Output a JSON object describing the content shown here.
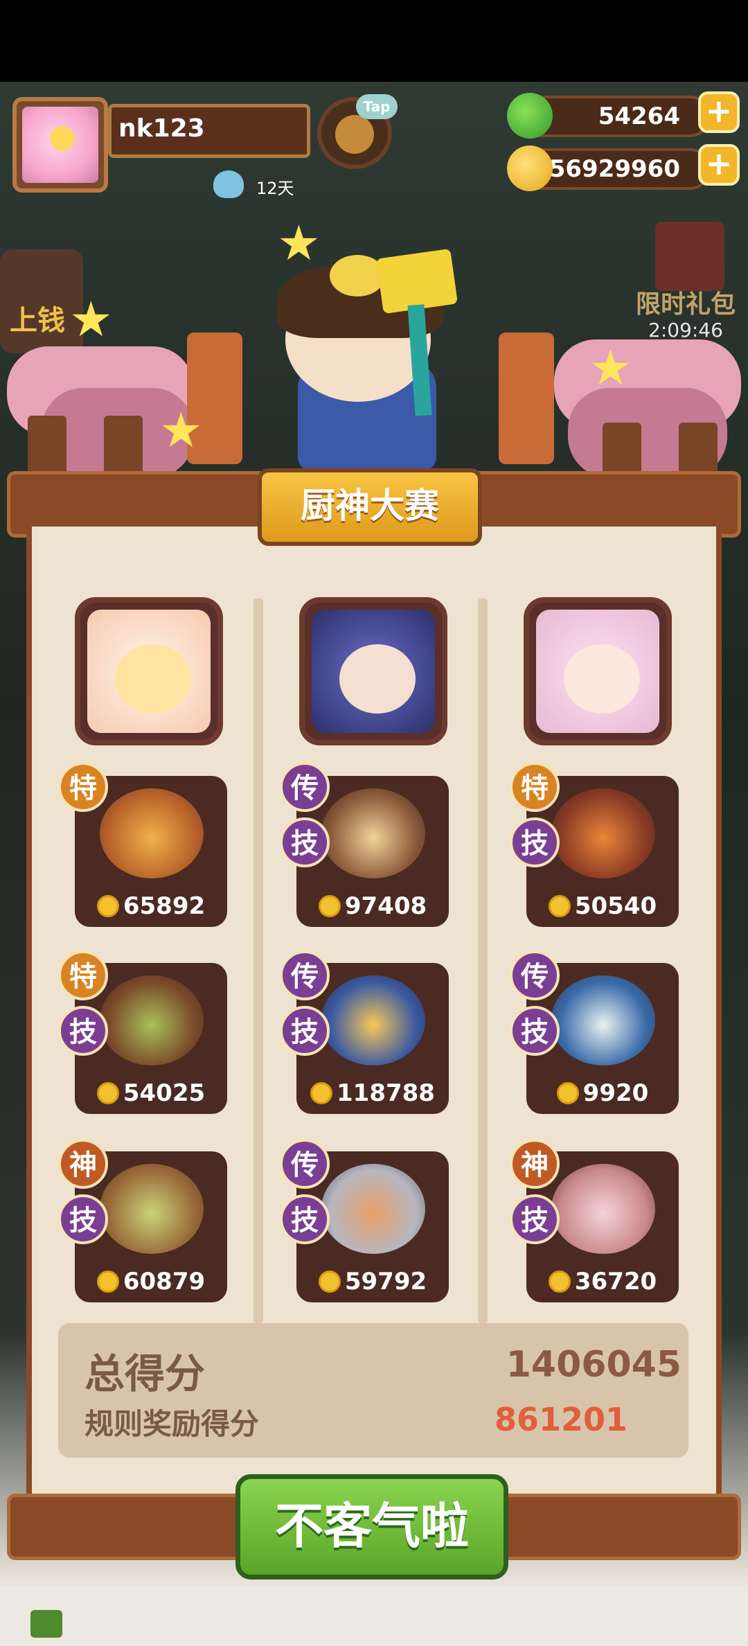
{
  "player": {
    "name": "nk123",
    "days": "12天",
    "tap_label": "Tap"
  },
  "resources": {
    "apples": "54264",
    "coins": "56929960",
    "plus": "+"
  },
  "side": {
    "left_label": "上钱",
    "gift_label": "限时礼包",
    "gift_timer": "2:09:46"
  },
  "contest": {
    "title": "厨神大赛",
    "columns": [
      {
        "dishes": [
          {
            "badges": [
              "特"
            ],
            "score": "65892"
          },
          {
            "badges": [
              "特",
              "技"
            ],
            "score": "54025"
          },
          {
            "badges": [
              "神",
              "技"
            ],
            "score": "60879"
          }
        ]
      },
      {
        "dishes": [
          {
            "badges": [
              "传",
              "技"
            ],
            "score": "97408"
          },
          {
            "badges": [
              "传",
              "技"
            ],
            "score": "118788"
          },
          {
            "badges": [
              "传",
              "技"
            ],
            "score": "59792"
          }
        ]
      },
      {
        "dishes": [
          {
            "badges": [
              "特",
              "技"
            ],
            "score": "50540"
          },
          {
            "badges": [
              "传",
              "技"
            ],
            "score": "9920"
          },
          {
            "badges": [
              "神",
              "技"
            ],
            "score": "36720"
          }
        ]
      }
    ],
    "total_label": "总得分",
    "total_value": "1406045",
    "bonus_label": "规则奖励得分",
    "bonus_value": "861201",
    "confirm_label": "不客气啦"
  },
  "colors": {
    "accent_gold": "#f3b62a",
    "bonus_red": "#e0603a",
    "total_brown": "#8a5a44",
    "confirm_green": "#6cbb36"
  }
}
